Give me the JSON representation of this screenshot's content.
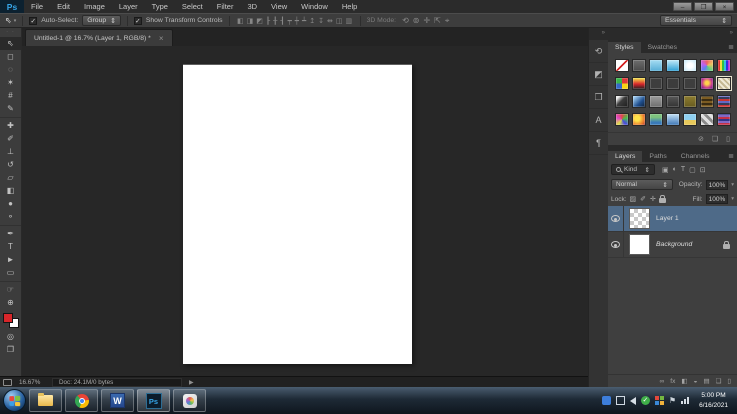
{
  "colors": {
    "accent_blue": "#37a6e9",
    "selection_blue": "#4e6a88",
    "foreground_red": "#d8262a",
    "canvas_white": "#ffffff"
  },
  "glyphs": {
    "dropdown": "⇕",
    "value_arrow": "▾",
    "check": "✓",
    "grip": "· ·",
    "collapse": "»",
    "panel_menu": "≣",
    "tab_close": "×",
    "status_arrow": "▶",
    "move_icon": "⇖",
    "caret_down": "▾"
  },
  "window": {
    "controls": [
      {
        "name": "minimize-button",
        "glyph": "–"
      },
      {
        "name": "restore-button",
        "glyph": "❐"
      },
      {
        "name": "close-button",
        "glyph": "×"
      }
    ]
  },
  "menu": {
    "logo": "Ps",
    "items": [
      "File",
      "Edit",
      "Image",
      "Layer",
      "Type",
      "Select",
      "Filter",
      "3D",
      "View",
      "Window",
      "Help"
    ]
  },
  "options": {
    "auto_select_label": "Auto-Select:",
    "group_value": "Group",
    "show_transform_label": "Show Transform Controls",
    "mode_label": "3D Mode:",
    "workspace": "Essentials",
    "align_icons": [
      {
        "name": "align-left-icon",
        "glyph": "◧"
      },
      {
        "name": "align-center-icon",
        "glyph": "◨"
      },
      {
        "name": "align-right-icon",
        "glyph": "◩"
      },
      {
        "name": "align-top-icon",
        "glyph": "┠"
      },
      {
        "name": "align-middle-icon",
        "glyph": "╂"
      },
      {
        "name": "align-bottom-icon",
        "glyph": "┨"
      },
      {
        "name": "distribute-top-icon",
        "glyph": "┯"
      },
      {
        "name": "distribute-middle-icon",
        "glyph": "┿"
      },
      {
        "name": "distribute-bottom-icon",
        "glyph": "┷"
      },
      {
        "name": "distribute-left-icon",
        "glyph": "↥"
      },
      {
        "name": "distribute-right-icon",
        "glyph": "↧"
      },
      {
        "name": "distribute-center-icon",
        "glyph": "⇹"
      },
      {
        "name": "auto-align-icon",
        "glyph": "◫"
      },
      {
        "name": "auto-blend-icon",
        "glyph": "▥"
      }
    ],
    "mode_icons": [
      {
        "name": "3d-rotate-icon",
        "glyph": "⟲"
      },
      {
        "name": "3d-roll-icon",
        "glyph": "⊚"
      },
      {
        "name": "3d-drag-icon",
        "glyph": "✛"
      },
      {
        "name": "3d-slide-icon",
        "glyph": "⇱"
      },
      {
        "name": "3d-scale-icon",
        "glyph": "⌖"
      }
    ]
  },
  "tab": {
    "title": "Untitled-1 @ 16.7% (Layer 1, RGB/8) *"
  },
  "toolbar": {
    "tools": [
      {
        "name": "move-tool",
        "glyph": "⇖",
        "active": true
      },
      {
        "name": "rectangular-marquee-tool",
        "glyph": "◻"
      },
      {
        "name": "lasso-tool",
        "glyph": "◌"
      },
      {
        "name": "quick-selection-tool",
        "glyph": "✶"
      },
      {
        "name": "crop-tool",
        "glyph": "#"
      },
      {
        "name": "eyedropper-tool",
        "glyph": "✎"
      },
      {
        "name": "spot-healing-brush-tool",
        "glyph": "✚",
        "sep": true
      },
      {
        "name": "brush-tool",
        "glyph": "✐"
      },
      {
        "name": "clone-stamp-tool",
        "glyph": "⊥"
      },
      {
        "name": "history-brush-tool",
        "glyph": "↺"
      },
      {
        "name": "eraser-tool",
        "glyph": "▱"
      },
      {
        "name": "gradient-tool",
        "glyph": "◧"
      },
      {
        "name": "blur-tool",
        "glyph": "●"
      },
      {
        "name": "dodge-tool",
        "glyph": "⚬"
      },
      {
        "name": "pen-tool",
        "glyph": "✒",
        "sep": true
      },
      {
        "name": "type-tool",
        "glyph": "T"
      },
      {
        "name": "path-selection-tool",
        "glyph": "►"
      },
      {
        "name": "rectangle-tool",
        "glyph": "▭"
      },
      {
        "name": "hand-tool",
        "glyph": "☞",
        "sep": true
      },
      {
        "name": "zoom-tool",
        "glyph": "⊕"
      }
    ],
    "bottom_tools": [
      {
        "name": "quick-mask-button",
        "glyph": "◎"
      },
      {
        "name": "screen-mode-button",
        "glyph": "❐"
      }
    ],
    "foreground": "#d8262a",
    "background": "#ffffff"
  },
  "dock_strip": {
    "icons": [
      {
        "name": "history-panel-icon",
        "glyph": "⟲"
      },
      {
        "name": "properties-panel-icon",
        "glyph": "◩"
      },
      {
        "name": "layer-comps-panel-icon",
        "glyph": "❐"
      },
      {
        "name": "character-panel-icon",
        "glyph": "A"
      },
      {
        "name": "paragraph-panel-icon",
        "glyph": "¶"
      }
    ]
  },
  "styles_panel": {
    "tabs": [
      {
        "label": "Styles",
        "active": true
      },
      {
        "label": "Swatches"
      }
    ],
    "swatches": [
      {
        "name": "style-swatch-none",
        "bg": "linear-gradient(135deg,#ffffff 44%,#d42222 44%,#d42222 56%,#ffffff 56%)"
      },
      {
        "name": "style-swatch",
        "bg": "linear-gradient(#6e6e6e,#494949)"
      },
      {
        "name": "style-swatch",
        "bg": "linear-gradient(#a5dcf2,#57aed6)"
      },
      {
        "name": "style-swatch",
        "bg": "linear-gradient(#c2e9f8,#2e9fd4)"
      },
      {
        "name": "style-swatch",
        "bg": "radial-gradient(#ffffff 30%,#bfe4f4)"
      },
      {
        "name": "style-swatch",
        "bg": "conic-gradient(#f06060,#f0c060,#60d080,#6080f0,#c060f0,#f06060)"
      },
      {
        "name": "style-swatch",
        "bg": "repeating-linear-gradient(90deg,#e03030 0 2px,#f0e040 2px 4px,#30c040 4px 6px,#30c0e0 6px 8px,#3030e0 8px 10px,#c030d0 10px 12px)"
      },
      {
        "name": "style-swatch",
        "bg": "conic-gradient(#e03838 25%,#f7d414 0 50%,#3668c8 0 75%,#39b54a 0)"
      },
      {
        "name": "style-swatch",
        "bg": "linear-gradient(180deg,#f3e74a,#d8262b 55%,#231f20)"
      },
      {
        "name": "style-swatch",
        "bg": "#3e3e3e"
      },
      {
        "name": "style-swatch",
        "bg": "#3c3c3c"
      },
      {
        "name": "style-swatch",
        "bg": "#3e3e3e"
      },
      {
        "name": "style-swatch",
        "bg": "radial-gradient(circle at 50% 45%,#ffd24a 20%,#c2338f 60%,#4d2679)"
      },
      {
        "name": "style-swatch",
        "bg": "repeating-linear-gradient(45deg,#f0ead6 0 2px,#c6b994 2px 4px)",
        "selected": true
      },
      {
        "name": "style-swatch",
        "bg": "linear-gradient(135deg,#ececec 15%,#3c3c3c 45%,#1d1d1d)"
      },
      {
        "name": "style-swatch",
        "bg": "linear-gradient(135deg,#a3cff2 10%,#1f4f8f 60%,#0e2038)"
      },
      {
        "name": "style-swatch",
        "bg": "linear-gradient(#9d9d9d,#6e6e6e)"
      },
      {
        "name": "style-swatch",
        "bg": "linear-gradient(#585858,#333333)"
      },
      {
        "name": "style-swatch",
        "bg": "linear-gradient(#8d7c30,#685c20)"
      },
      {
        "name": "style-swatch",
        "bg": "repeating-linear-gradient(0deg,#7c5c23 0 2px,#3a2c12 2px 4px)"
      },
      {
        "name": "style-swatch",
        "bg": "repeating-linear-gradient(0deg,#c83434 0 2px,#343c5c 2px 4px,#6468c4 4px 6px)"
      },
      {
        "name": "style-swatch",
        "bg": "conic-gradient(#e04848,#48c048,#4848e0,#e0e048,#e048c8,#e04848)"
      },
      {
        "name": "style-swatch",
        "bg": "radial-gradient(circle at 35% 40%,#ffe34a 25%,#e8742a 70%,#a23636)"
      },
      {
        "name": "style-swatch",
        "bg": "linear-gradient(180deg,#7ec47e 30%,#3a7ab8 75%)"
      },
      {
        "name": "style-swatch",
        "bg": "linear-gradient(180deg,#c4e2f6,#3f77b5)"
      },
      {
        "name": "style-swatch",
        "bg": "linear-gradient(180deg,#8fd0f0 55%,#e8c95a 55%)"
      },
      {
        "name": "style-swatch",
        "bg": "repeating-linear-gradient(45deg,#e0e0e0 0 3px,#8a8a8a 3px 6px)"
      },
      {
        "name": "style-swatch",
        "bg": "repeating-linear-gradient(0deg,#c43048 0 2px,#8468c4 2px 4px,#30348c 4px 6px)"
      }
    ],
    "footer_icons": [
      {
        "name": "clear-style-icon",
        "glyph": "⊘"
      },
      {
        "name": "new-style-icon",
        "glyph": "❏"
      },
      {
        "name": "delete-style-icon",
        "glyph": "▯"
      }
    ]
  },
  "layers_panel": {
    "tabs": [
      {
        "label": "Layers",
        "active": true
      },
      {
        "label": "Paths"
      },
      {
        "label": "Channels"
      }
    ],
    "kind_label": "Kind",
    "filter_icons": [
      {
        "name": "filter-pixel-layers-icon",
        "glyph": "▣"
      },
      {
        "name": "filter-adjustment-layers-icon",
        "glyph": "◐"
      },
      {
        "name": "filter-type-layers-icon",
        "glyph": "T"
      },
      {
        "name": "filter-shape-layers-icon",
        "glyph": "▢"
      },
      {
        "name": "filter-smart-objects-icon",
        "glyph": "⊡"
      }
    ],
    "blend_mode": "Normal",
    "opacity_label": "Opacity:",
    "opacity_value": "100%",
    "lock_label": "Lock:",
    "lock_icons": [
      {
        "name": "lock-transparency-icon",
        "glyph": "▨"
      },
      {
        "name": "lock-image-icon",
        "glyph": "✐"
      },
      {
        "name": "lock-position-icon",
        "glyph": "✛"
      }
    ],
    "fill_label": "Fill:",
    "fill_value": "100%",
    "layer1_name": "Layer 1",
    "background_name": "Background",
    "footer_icons": [
      {
        "name": "link-layers-icon",
        "glyph": "∞"
      },
      {
        "name": "layer-effects-icon",
        "glyph": "fx"
      },
      {
        "name": "layer-mask-icon",
        "glyph": "◧"
      },
      {
        "name": "adjustment-layer-icon",
        "glyph": "◒"
      },
      {
        "name": "layer-group-icon",
        "glyph": "▤"
      },
      {
        "name": "new-layer-icon",
        "glyph": "❏"
      },
      {
        "name": "delete-layer-icon",
        "glyph": "▯"
      }
    ]
  },
  "statusbar": {
    "zoom": "16.67%",
    "doc": "Doc: 24.1M/0 bytes"
  },
  "taskbar": {
    "word_glyph": "W",
    "ps_glyph": "Ps",
    "clock_time": "5:00 PM",
    "clock_date": "6/16/2021"
  }
}
